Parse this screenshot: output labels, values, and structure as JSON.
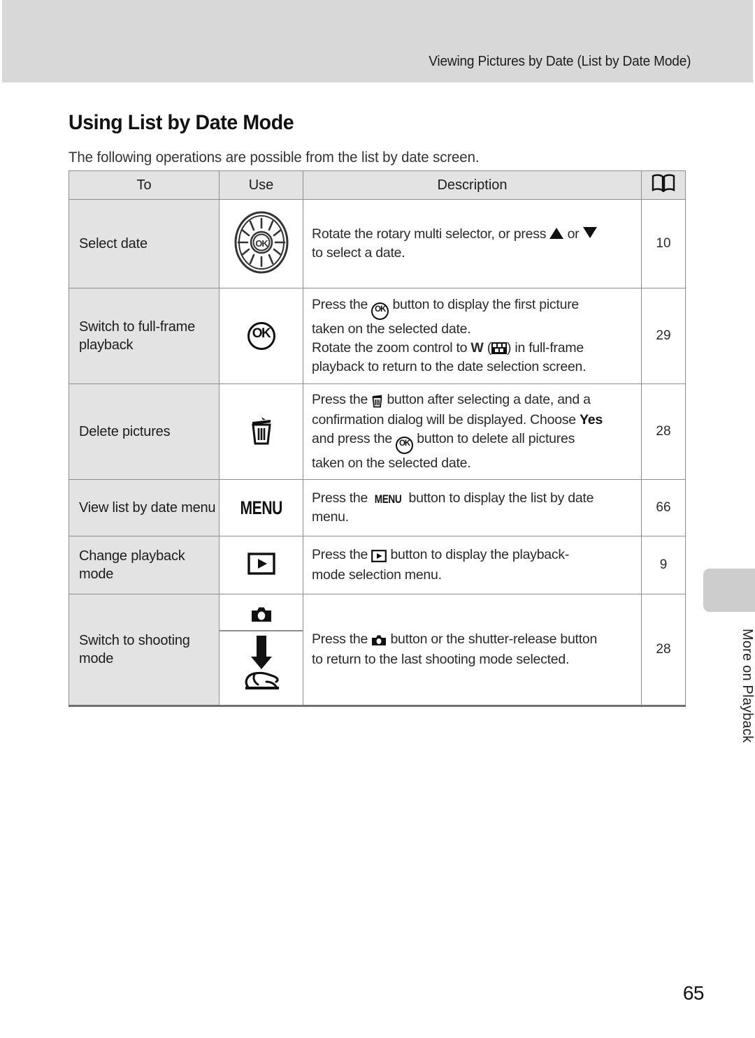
{
  "header": {
    "running_head": "Viewing Pictures by Date (List by Date Mode)"
  },
  "section": {
    "title": "Using List by Date Mode",
    "intro": "The following operations are possible from the list by date screen."
  },
  "table": {
    "columns": {
      "to": "To",
      "use": "Use",
      "description": "Description",
      "reference": "book-icon"
    },
    "rows": [
      {
        "to": "Select date",
        "use_icon": "rotary-multi-selector-icon",
        "description_lines": [
          "Rotate the rotary multi selector, or press ▲ or ▼",
          "to select a date."
        ],
        "desc_part_1": "Rotate the rotary multi selector, or press ",
        "desc_part_2": " or ",
        "desc_part_3": "to select a date.",
        "ref": "10"
      },
      {
        "to": "Switch to full-frame playback",
        "use_icon": "ok-button-icon",
        "desc_l1_a": "Press the ",
        "desc_l1_b": " button to display the first picture",
        "desc_l2": "taken on the selected date.",
        "desc_l3_a": "Rotate the zoom control to ",
        "desc_l3_w": "W",
        "desc_l3_b": " (",
        "desc_l3_c": ") in full-frame",
        "desc_l4": "playback to return to the date selection screen.",
        "ref": "29"
      },
      {
        "to": "Delete pictures",
        "use_icon": "trash-icon",
        "desc_l1_a": "Press the ",
        "desc_l1_b": " button after selecting a date, and a",
        "desc_l2_a": "confirmation dialog will be displayed. Choose ",
        "desc_l2_bold": "Yes",
        "desc_l3_a": "and press the ",
        "desc_l3_b": " button to delete all pictures",
        "desc_l4": "taken on the selected date.",
        "ref": "28"
      },
      {
        "to": "View list by date menu",
        "use_icon": "menu-button-icon",
        "use_label": "MENU",
        "desc_l1_a": "Press the ",
        "desc_l1_menu": "MENU",
        "desc_l1_b": " button to display the list by date",
        "desc_l2": "menu.",
        "ref": "66"
      },
      {
        "to": "Change playback mode",
        "use_icon": "playback-button-icon",
        "desc_l1_a": "Press the ",
        "desc_l1_b": " button to display the playback-",
        "desc_l2": "mode selection menu.",
        "ref": "9"
      },
      {
        "to": "Switch to shooting mode",
        "use_icon_top": "camera-button-icon",
        "use_icon_bottom": "shutter-release-press-icon",
        "desc_l1_a": "Press the ",
        "desc_l1_b": " button or the shutter-release button",
        "desc_l2": "to return to the last shooting mode selected.",
        "ref": "28"
      }
    ]
  },
  "thumb_tab": {
    "label": "More on Playback"
  },
  "folio": {
    "page_number": "65"
  },
  "colors": {
    "header_band": "#d8d8d8",
    "row_label_bg": "#e3e3e3",
    "tab_gray": "#cdcdcd",
    "rule_dark": "#6f6f6f",
    "rule_light": "#8e8e8e"
  }
}
